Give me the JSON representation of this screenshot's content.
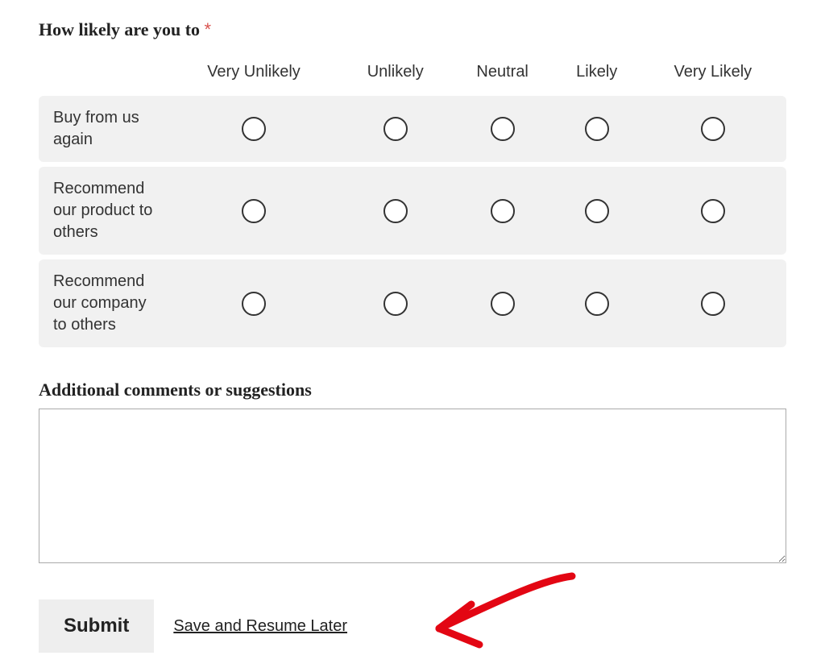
{
  "question": {
    "title": "How likely are you to",
    "required_marker": "*"
  },
  "scale": {
    "headers": [
      "Very Unlikely",
      "Unlikely",
      "Neutral",
      "Likely",
      "Very Likely"
    ]
  },
  "rows": [
    {
      "label": "Buy from us again"
    },
    {
      "label": "Recommend our product to others"
    },
    {
      "label": "Recommend our company to others"
    }
  ],
  "comments": {
    "label": "Additional comments or suggestions",
    "value": ""
  },
  "footer": {
    "submit_label": "Submit",
    "save_label": "Save and Resume Later"
  }
}
